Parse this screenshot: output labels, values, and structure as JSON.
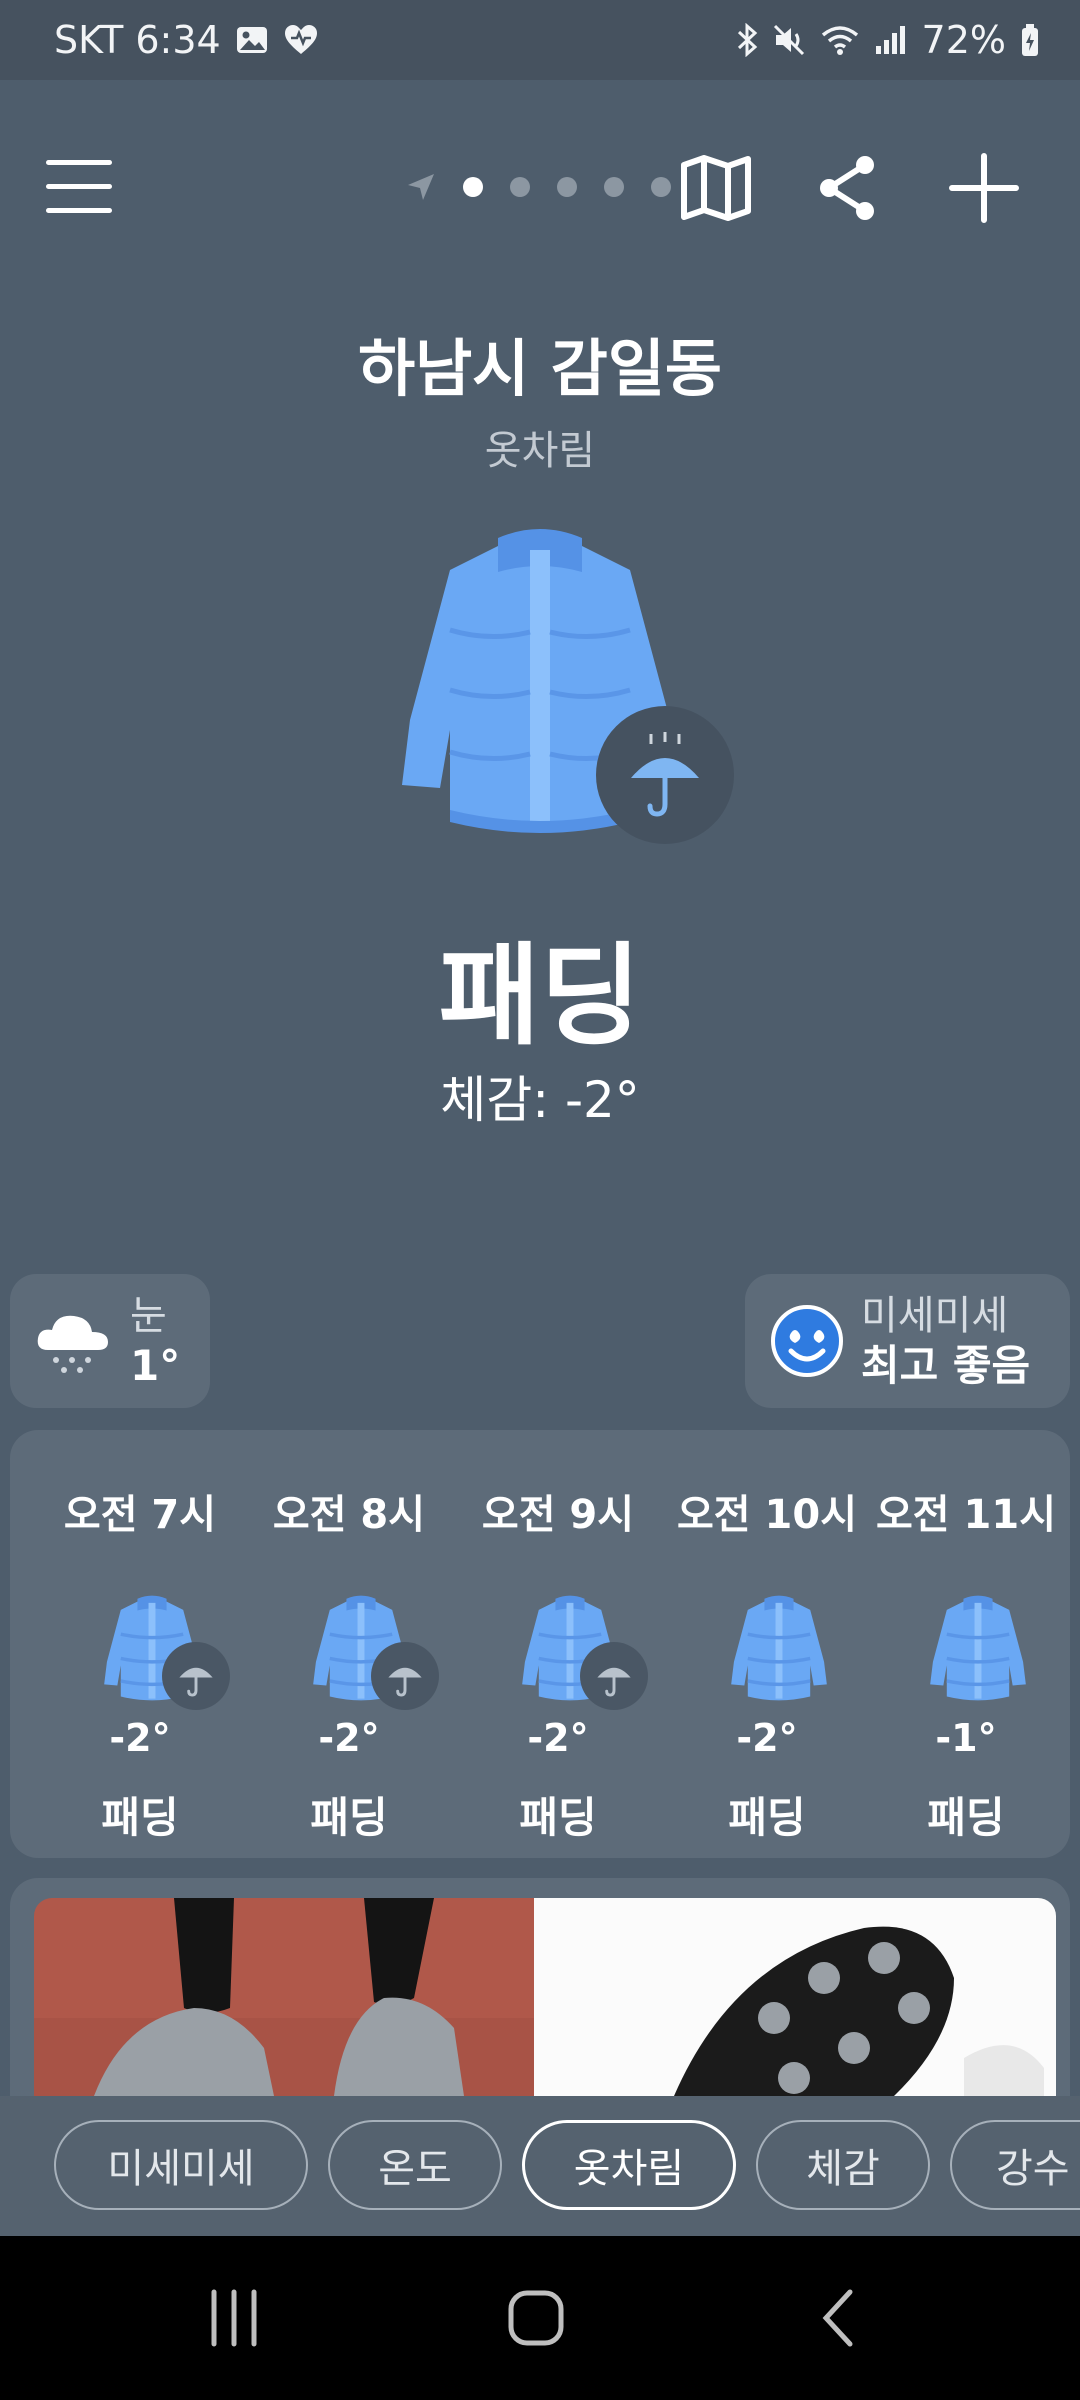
{
  "status_bar": {
    "carrier_time": "SKT 6:34",
    "battery": "72%"
  },
  "header": {
    "page_dots": 5,
    "active_page": 1,
    "location": "하남시 감일동",
    "subtitle": "옷차림"
  },
  "main": {
    "outfit_icon": "puffer-jacket-icon",
    "badge_icon": "umbrella-icon",
    "outfit_name": "패딩",
    "feels_like": "체감: -2°"
  },
  "chips": {
    "weather": {
      "icon": "snow-cloud-icon",
      "label": "눈",
      "value": "1°"
    },
    "dust": {
      "icon": "smile-heart-eyes-icon",
      "label": "미세미세",
      "value": "최고 좋음"
    }
  },
  "hourly": [
    {
      "time": "오전 7시",
      "temp": "-2°",
      "outfit": "패딩",
      "umbrella": true
    },
    {
      "time": "오전 8시",
      "temp": "-2°",
      "outfit": "패딩",
      "umbrella": true
    },
    {
      "time": "오전 9시",
      "temp": "-2°",
      "outfit": "패딩",
      "umbrella": true
    },
    {
      "time": "오전 10시",
      "temp": "-2°",
      "outfit": "패딩",
      "umbrella": false
    },
    {
      "time": "오전 11시",
      "temp": "-1°",
      "outfit": "패딩",
      "umbrella": false
    }
  ],
  "tabs": [
    {
      "label": "미세미세",
      "active": false
    },
    {
      "label": "온도",
      "active": false
    },
    {
      "label": "옷차림",
      "active": true
    },
    {
      "label": "체감",
      "active": false
    },
    {
      "label": "강수",
      "active": false
    }
  ],
  "colors": {
    "background": "#4e5d6c",
    "card": "#5d6b79",
    "jacket": "#6aa8f4",
    "accent": "#7fb6f2"
  }
}
